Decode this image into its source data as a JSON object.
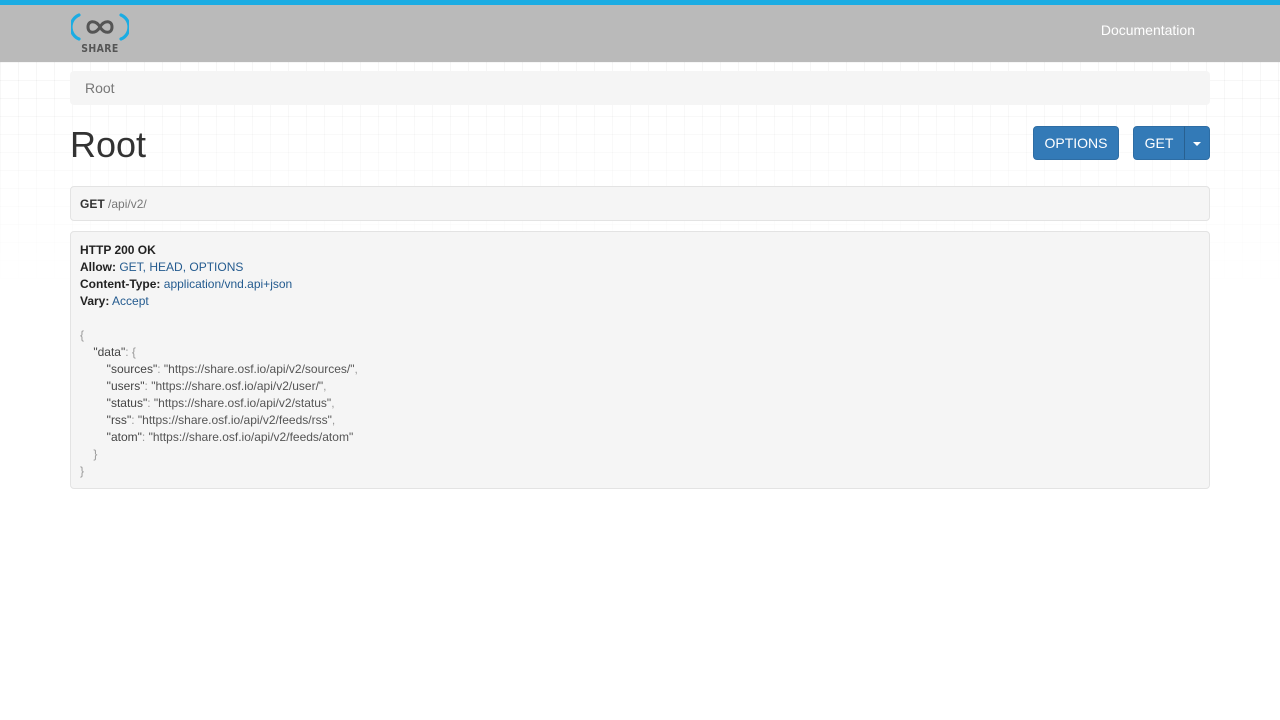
{
  "navbar": {
    "logo_text": "SHARE",
    "documentation_label": "Documentation"
  },
  "breadcrumb": {
    "current": "Root"
  },
  "page": {
    "title": "Root"
  },
  "buttons": {
    "options_label": "OPTIONS",
    "get_label": "GET"
  },
  "request": {
    "method": "GET",
    "path": "/api/v2/"
  },
  "response": {
    "status_line": "HTTP 200 OK",
    "headers": [
      {
        "name": "Allow:",
        "value": "GET, HEAD, OPTIONS"
      },
      {
        "name": "Content-Type:",
        "value": "application/vnd.api+json"
      },
      {
        "name": "Vary:",
        "value": "Accept"
      }
    ],
    "body": {
      "root_key": "data",
      "entries": [
        {
          "key": "sources",
          "value": "https://share.osf.io/api/v2/sources/"
        },
        {
          "key": "users",
          "value": "https://share.osf.io/api/v2/user/"
        },
        {
          "key": "status",
          "value": "https://share.osf.io/api/v2/status"
        },
        {
          "key": "rss",
          "value": "https://share.osf.io/api/v2/feeds/rss"
        },
        {
          "key": "atom",
          "value": "https://share.osf.io/api/v2/feeds/atom"
        }
      ]
    }
  },
  "colors": {
    "accent_bar": "#1bace3",
    "navbar_bg": "#bababa",
    "primary_button": "#337ab7",
    "header_value_link": "#245b8f"
  }
}
